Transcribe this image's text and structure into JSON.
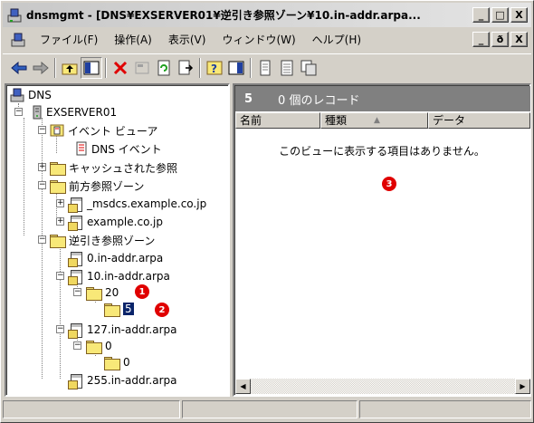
{
  "window": {
    "title": "dnsmgmt - [DNS¥EXSERVER01¥逆引き参照ゾーン¥10.in-addr.arpa..."
  },
  "title_buttons": [
    "_",
    "□",
    "X"
  ],
  "menu": [
    "ファイル(F)",
    "操作(A)",
    "表示(V)",
    "ウィンドウ(W)",
    "ヘルプ(H)"
  ],
  "mdi_buttons": [
    "_",
    "ð",
    "X"
  ],
  "toolbar": [
    "back-icon",
    "forward-icon",
    "up-folder-icon",
    "show-tree-icon",
    "delete-icon",
    "properties-icon",
    "refresh-icon",
    "export-icon",
    "help-icon",
    "console-icon",
    "new-record-icon",
    "new-host-icon",
    "new-alias-icon"
  ],
  "tree": {
    "root": "DNS",
    "server": "EXSERVER01",
    "event_viewer": "イベント ビューア",
    "dns_event": "DNS イベント",
    "cached": "キャッシュされた参照",
    "forward": "前方参照ゾーン",
    "msdcs": "_msdcs.example.co.jp",
    "example": "example.co.jp",
    "reverse": "逆引き参照ゾーン",
    "zone0": "0.in-addr.arpa",
    "zone10": "10.in-addr.arpa",
    "sub20": "20",
    "sub5": "5",
    "zone127": "127.in-addr.arpa",
    "sub127_0": "0",
    "sub127_0_0": "0",
    "zone255": "255.in-addr.arpa"
  },
  "detail": {
    "count": "5",
    "records": "0 個のレコード",
    "columns": [
      "名前",
      "種類",
      "データ"
    ],
    "sort_arrow": "▲",
    "empty": "このビューに表示する項目はありません。"
  },
  "callouts": [
    "1",
    "2",
    "3"
  ],
  "colors": {
    "callout": "#e00000",
    "selection": "#0a246a",
    "header": "#808080"
  }
}
